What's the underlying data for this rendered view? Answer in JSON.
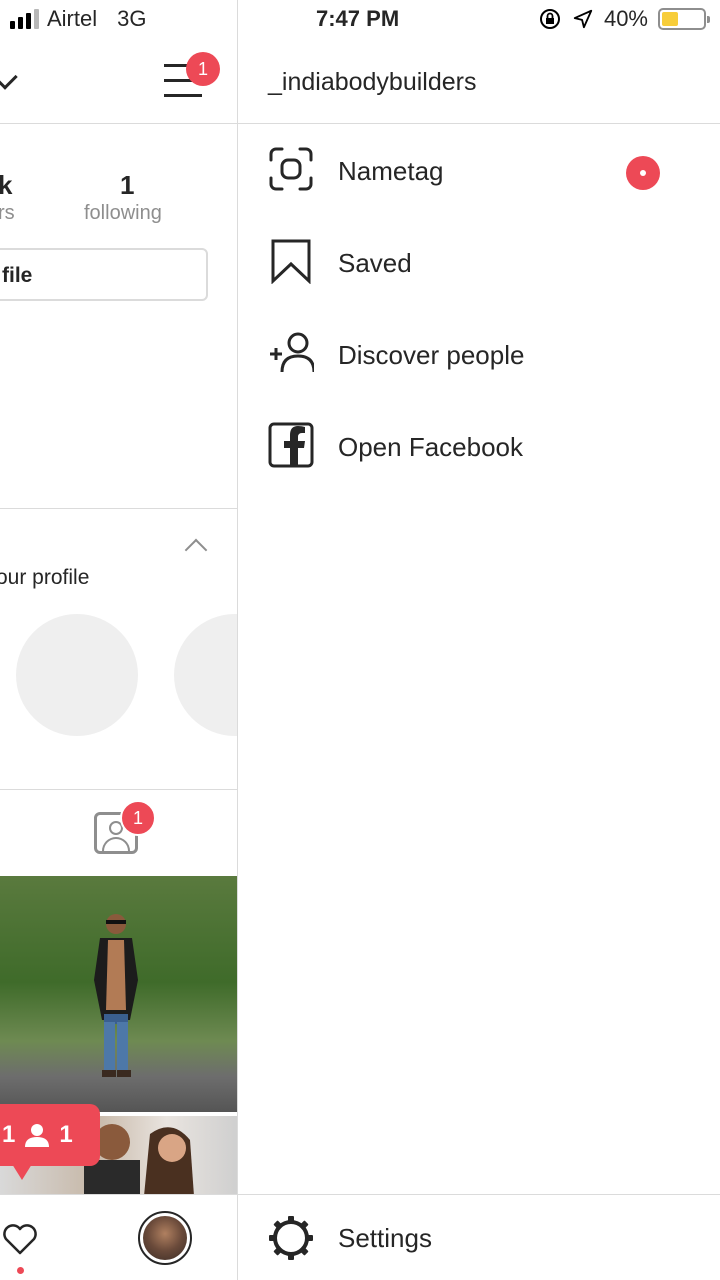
{
  "status_bar": {
    "carrier": "Airtel",
    "network": "3G",
    "time": "7:47 PM",
    "battery": "40%",
    "battery_level": 0.4,
    "battery_color": "#f7cd3a"
  },
  "profile_panel": {
    "menu_badge": "1",
    "followers_count": "k",
    "followers_label": "rs",
    "following_count": "1",
    "following_label": "following",
    "edit_profile_label": "file",
    "suggestions_text": "our profile",
    "tagged_badge": "1",
    "activity_bubble_left": "1",
    "activity_bubble_count": "1"
  },
  "side_menu": {
    "username": "_indiabodybuilders",
    "items": [
      {
        "label": "Nametag",
        "icon": "nametag-icon"
      },
      {
        "label": "Saved",
        "icon": "bookmark-icon"
      },
      {
        "label": "Discover people",
        "icon": "add-person-icon"
      },
      {
        "label": "Open Facebook",
        "icon": "facebook-icon"
      }
    ],
    "settings_label": "Settings"
  },
  "colors": {
    "accent_red": "#ed4956",
    "text": "#262626",
    "muted": "#8e8e8e",
    "divider": "#dbdbdb"
  }
}
